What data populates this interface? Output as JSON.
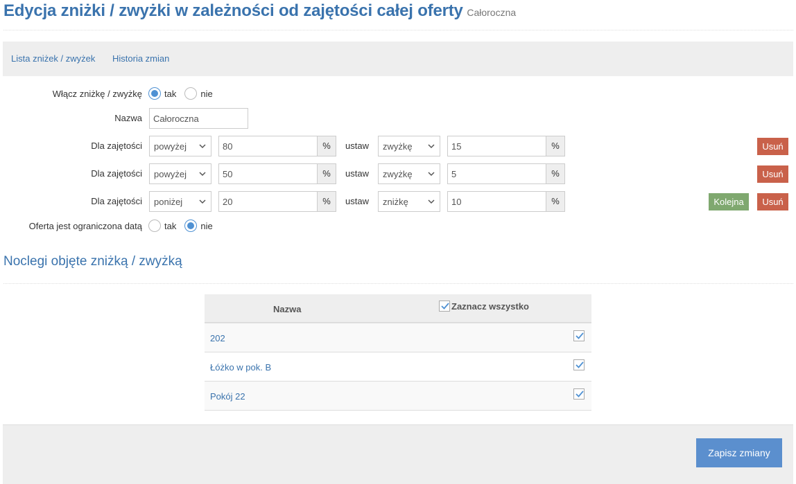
{
  "header": {
    "title": "Edycja zniżki / zwyżki w zależności od zajętości całej oferty",
    "subtitle": "Całoroczna"
  },
  "tabs": [
    {
      "label": "Lista zniżek / zwyżek"
    },
    {
      "label": "Historia zmian"
    }
  ],
  "form": {
    "enable": {
      "label": "Włącz zniżkę / zwyżkę",
      "options": [
        "tak",
        "nie"
      ],
      "selected": "tak"
    },
    "name": {
      "label": "Nazwa",
      "value": "Całoroczna"
    },
    "rules": [
      {
        "label": "Dla zajętości",
        "condition": "powyżej",
        "occupancy": "80",
        "unit1": "%",
        "set_label": "ustaw",
        "type": "zwyżkę",
        "amount": "15",
        "unit2": "%",
        "remove_label": "Usuń"
      },
      {
        "label": "Dla zajętości",
        "condition": "powyżej",
        "occupancy": "50",
        "unit1": "%",
        "set_label": "ustaw",
        "type": "zwyżkę",
        "amount": "5",
        "unit2": "%",
        "remove_label": "Usuń"
      },
      {
        "label": "Dla zajętości",
        "condition": "poniżej",
        "occupancy": "20",
        "unit1": "%",
        "set_label": "ustaw",
        "type": "zniżkę",
        "amount": "10",
        "unit2": "%",
        "next_label": "Kolejna",
        "remove_label": "Usuń"
      }
    ],
    "date_limited": {
      "label": "Oferta jest ograniczona datą",
      "options": [
        "tak",
        "nie"
      ],
      "selected": "nie"
    }
  },
  "section": {
    "title": "Noclegi objęte zniżką / zwyżką"
  },
  "table": {
    "col_name": "Nazwa",
    "select_all_label": "Zaznacz wszystko",
    "rows": [
      {
        "name": "202",
        "checked": true
      },
      {
        "name": "Łóżko w pok. B",
        "checked": true
      },
      {
        "name": "Pokój 22",
        "checked": true
      }
    ]
  },
  "footer": {
    "save_label": "Zapisz zmiany"
  },
  "colors": {
    "accent": "#3a73ad",
    "danger": "#c9614a",
    "success": "#7fa86f",
    "primary_button": "#5b8fce"
  }
}
